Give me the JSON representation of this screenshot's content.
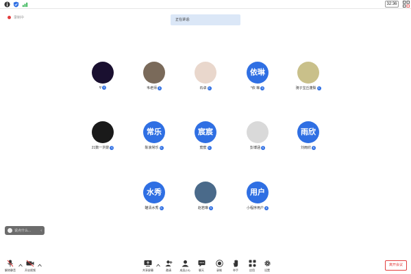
{
  "statusbar": {
    "time": "32:36"
  },
  "recording": {
    "label": "录制中"
  },
  "speaking_banner": {
    "text": "正在讲话:"
  },
  "participants": [
    {
      "name": "∀",
      "avatar_text": "",
      "avatar_color": "#1a1030"
    },
    {
      "name": "韦老师",
      "avatar_text": "",
      "avatar_color": "#7a6a5a"
    },
    {
      "name": "石卓",
      "avatar_text": "",
      "avatar_color": "#e9d7cc"
    },
    {
      "name": "*依 琳",
      "avatar_text": "依琳",
      "avatar_color": "#2f6fe3"
    },
    {
      "name": "骑子宝丘蓬梨",
      "avatar_text": "",
      "avatar_color": "#c9c08a"
    },
    {
      "name": "21数一洪景",
      "avatar_text": "",
      "avatar_color": "#1a1a1a"
    },
    {
      "name": "陈浪常乐",
      "avatar_text": "常乐",
      "avatar_color": "#2f6fe3"
    },
    {
      "name": "宸宸",
      "avatar_text": "宸宸",
      "avatar_color": "#2f6fe3"
    },
    {
      "name": "彭博涵",
      "avatar_text": "",
      "avatar_color": "#d9d9d9"
    },
    {
      "name": "刘雨欣",
      "avatar_text": "雨欣",
      "avatar_color": "#2f6fe3"
    },
    {
      "name": "瞄清水秀",
      "avatar_text": "水秀",
      "avatar_color": "#2f6fe3"
    },
    {
      "name": "赵若琳",
      "avatar_text": "",
      "avatar_color": "#4a6a8a"
    },
    {
      "name": "小程序用户",
      "avatar_text": "用户",
      "avatar_color": "#2f6fe3"
    }
  ],
  "badge_label": "S",
  "chat": {
    "placeholder": "说点什么..."
  },
  "toolbar": {
    "mute": "解除静音",
    "video": "开启视频",
    "share": "共享屏幕",
    "invite": "邀请",
    "members": "成员(13)",
    "chat": "聊天",
    "record": "录制",
    "hand": "举手",
    "apps": "应用",
    "settings": "设置",
    "leave": "离开会议"
  },
  "colors": {
    "accent": "#2f6fe3",
    "danger": "#e23c3c",
    "banner": "#dbe7f7"
  }
}
